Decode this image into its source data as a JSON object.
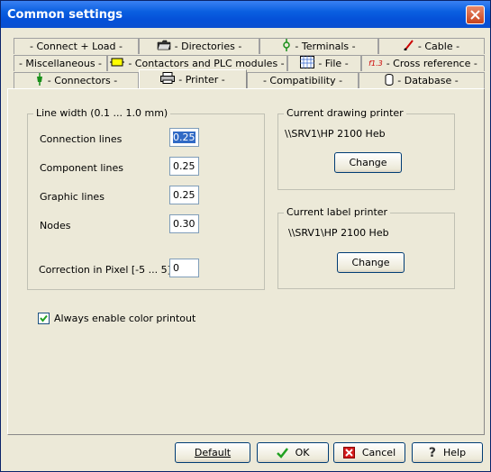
{
  "window": {
    "title": "Common settings"
  },
  "tabs": {
    "row1": [
      {
        "label": "- Connect + Load -",
        "icon": ""
      },
      {
        "label": "- Directories -",
        "icon": "folder-icon"
      },
      {
        "label": "- Terminals -",
        "icon": "terminal-icon"
      },
      {
        "label": "- Cable -",
        "icon": "cable-icon"
      }
    ],
    "row2": [
      {
        "label": "- Miscellaneous -",
        "icon": ""
      },
      {
        "label": "- Contactors and PLC modules -",
        "icon": "contactor-icon"
      },
      {
        "label": "- File -",
        "icon": "file-grid-icon"
      },
      {
        "label": "- Cross reference -",
        "icon": "cross-reference-icon",
        "icon_text": "f1.3"
      }
    ],
    "row3": [
      {
        "label": "- Connectors -",
        "icon": "connector-icon"
      },
      {
        "label": "- Printer -",
        "icon": "printer-icon",
        "active": true
      },
      {
        "label": "- Compatibility -",
        "icon": ""
      },
      {
        "label": "- Database -",
        "icon": "database-icon"
      }
    ]
  },
  "line_width": {
    "title": "Line width  (0.1 ... 1.0 mm)",
    "connection_lines": {
      "label": "Connection lines",
      "value": "0.25"
    },
    "component_lines": {
      "label": "Component lines",
      "value": "0.25"
    },
    "graphic_lines": {
      "label": "Graphic lines",
      "value": "0.25"
    },
    "nodes": {
      "label": "Nodes",
      "value": "0.30"
    },
    "correction": {
      "label": "Correction in Pixel [-5 ... 5]",
      "value": "0"
    }
  },
  "drawing_printer": {
    "title": "Current drawing printer",
    "name": "\\\\SRV1\\HP 2100 Heb",
    "button": "Change"
  },
  "label_printer": {
    "title": "Current label printer",
    "name": "\\\\SRV1\\HP 2100 Heb",
    "button": "Change"
  },
  "color_printout": {
    "label": "Always enable color printout",
    "checked": true
  },
  "footer": {
    "default": "Default",
    "ok": "OK",
    "cancel": "Cancel",
    "help": "Help"
  },
  "colors": {
    "title_bar": "#0a5fe0",
    "dialog_bg": "#ece9d8",
    "selection": "#316ac5"
  }
}
